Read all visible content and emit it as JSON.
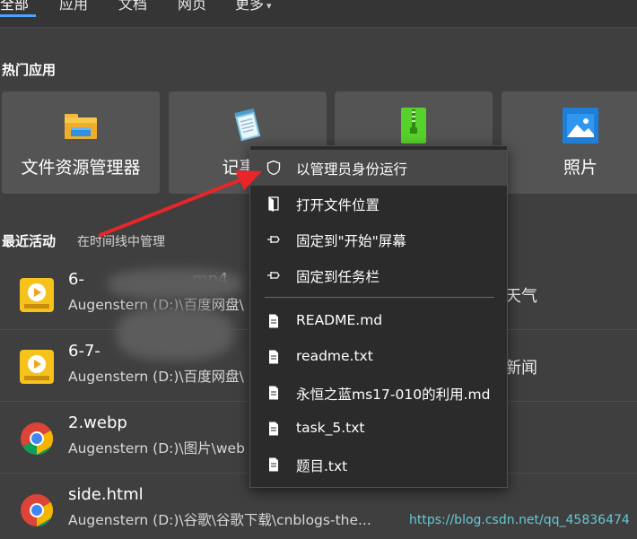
{
  "top_tabs": [
    {
      "label": "全部",
      "active": true
    },
    {
      "label": "应用",
      "active": false
    },
    {
      "label": "文档",
      "active": false
    },
    {
      "label": "网页",
      "active": false
    },
    {
      "label": "更多",
      "active": false
    }
  ],
  "hot_apps": {
    "title": "热门应用",
    "items": [
      {
        "label": "文件资源管理器",
        "icon": "folder-icon"
      },
      {
        "label": "记事本",
        "icon": "notepad-icon"
      },
      {
        "label": "",
        "icon": "winrar-archive-icon"
      },
      {
        "label": "照片",
        "icon": "photos-icon"
      }
    ]
  },
  "recent": {
    "title": "最近活动",
    "timeline_link": "在时间线中管理",
    "items": [
      {
        "title": "6-",
        "title_rest": "mp4",
        "path": "Augenstern (D:)\\百度网盘\\",
        "icon": "potplayer-icon",
        "right_text": "天气"
      },
      {
        "title": "6-7-",
        "title_rest": "",
        "path": "Augenstern (D:)\\百度网盘\\",
        "icon": "potplayer-icon",
        "right_text": "新闻"
      },
      {
        "title": "2.webp",
        "title_rest": "",
        "path": "Augenstern (D:)\\图片\\web",
        "icon": "chrome-icon",
        "right_text": ""
      },
      {
        "title": "side.html",
        "title_rest": "",
        "path": "Augenstern (D:)\\谷歌\\谷歌下载\\cnblogs-the...",
        "icon": "chrome-icon",
        "right_text": ""
      }
    ]
  },
  "context_menu": {
    "items": [
      {
        "label": "以管理员身份运行",
        "icon": "shield-icon",
        "highlighted": true
      },
      {
        "label": "打开文件位置",
        "icon": "open-file-location-icon",
        "highlighted": false
      },
      {
        "label": "固定到\"开始\"屏幕",
        "icon": "pin-icon",
        "highlighted": false
      },
      {
        "label": "固定到任务栏",
        "icon": "pin-icon",
        "highlighted": false
      }
    ],
    "recent_files": [
      {
        "label": "README.md",
        "icon": "document-icon"
      },
      {
        "label": "readme.txt",
        "icon": "document-icon"
      },
      {
        "label": "永恒之蓝ms17-010的利用.md",
        "icon": "document-icon"
      },
      {
        "label": "task_5.txt",
        "icon": "document-icon"
      },
      {
        "label": "题目.txt",
        "icon": "document-icon"
      }
    ]
  },
  "annotation": {
    "color": "#e8262a"
  },
  "watermark": "https://blog.csdn.net/qq_45836474",
  "colors": {
    "background": "#3f3f3f",
    "tile": "#545454",
    "menu": "#2b2b2b",
    "menu_highlight": "#484848",
    "accent": "#4fa3ff"
  }
}
